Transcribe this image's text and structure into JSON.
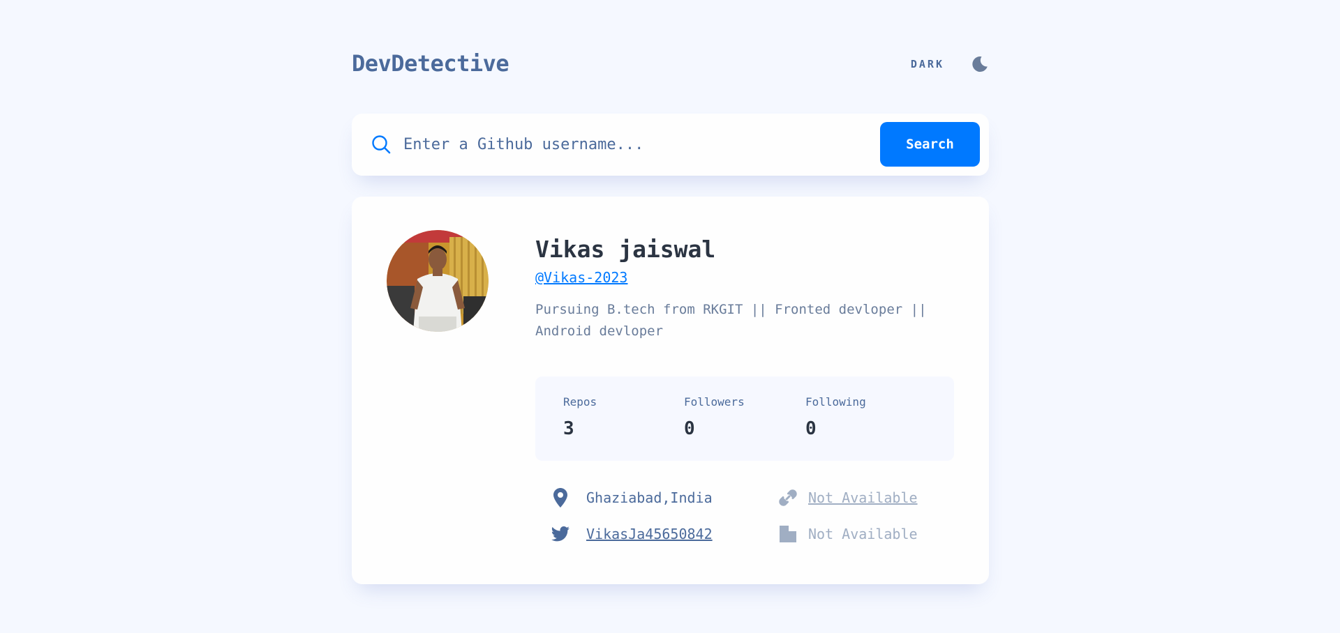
{
  "header": {
    "logo": "DevDetective",
    "theme_label": "DARK",
    "theme_icon": "moon-icon"
  },
  "search": {
    "placeholder": "Enter a Github username...",
    "value": "",
    "button_label": "Search",
    "icon": "search-icon"
  },
  "profile": {
    "name": "Vikas jaiswal",
    "login": "@Vikas-2023",
    "bio": "Pursuing B.tech from RKGIT || Fronted devloper || Android devloper",
    "stats": [
      {
        "label": "Repos",
        "value": "3"
      },
      {
        "label": "Followers",
        "value": "0"
      },
      {
        "label": "Following",
        "value": "0"
      }
    ],
    "location": "Ghaziabad,India",
    "website": "Not Available",
    "twitter": "VikasJa45650842",
    "company": "Not Available"
  },
  "colors": {
    "background": "#f5f8ff",
    "accent": "#0079ff",
    "primary_text": "#2b3442",
    "secondary_text": "#4b6a9b",
    "muted_text": "#a0aec3"
  }
}
